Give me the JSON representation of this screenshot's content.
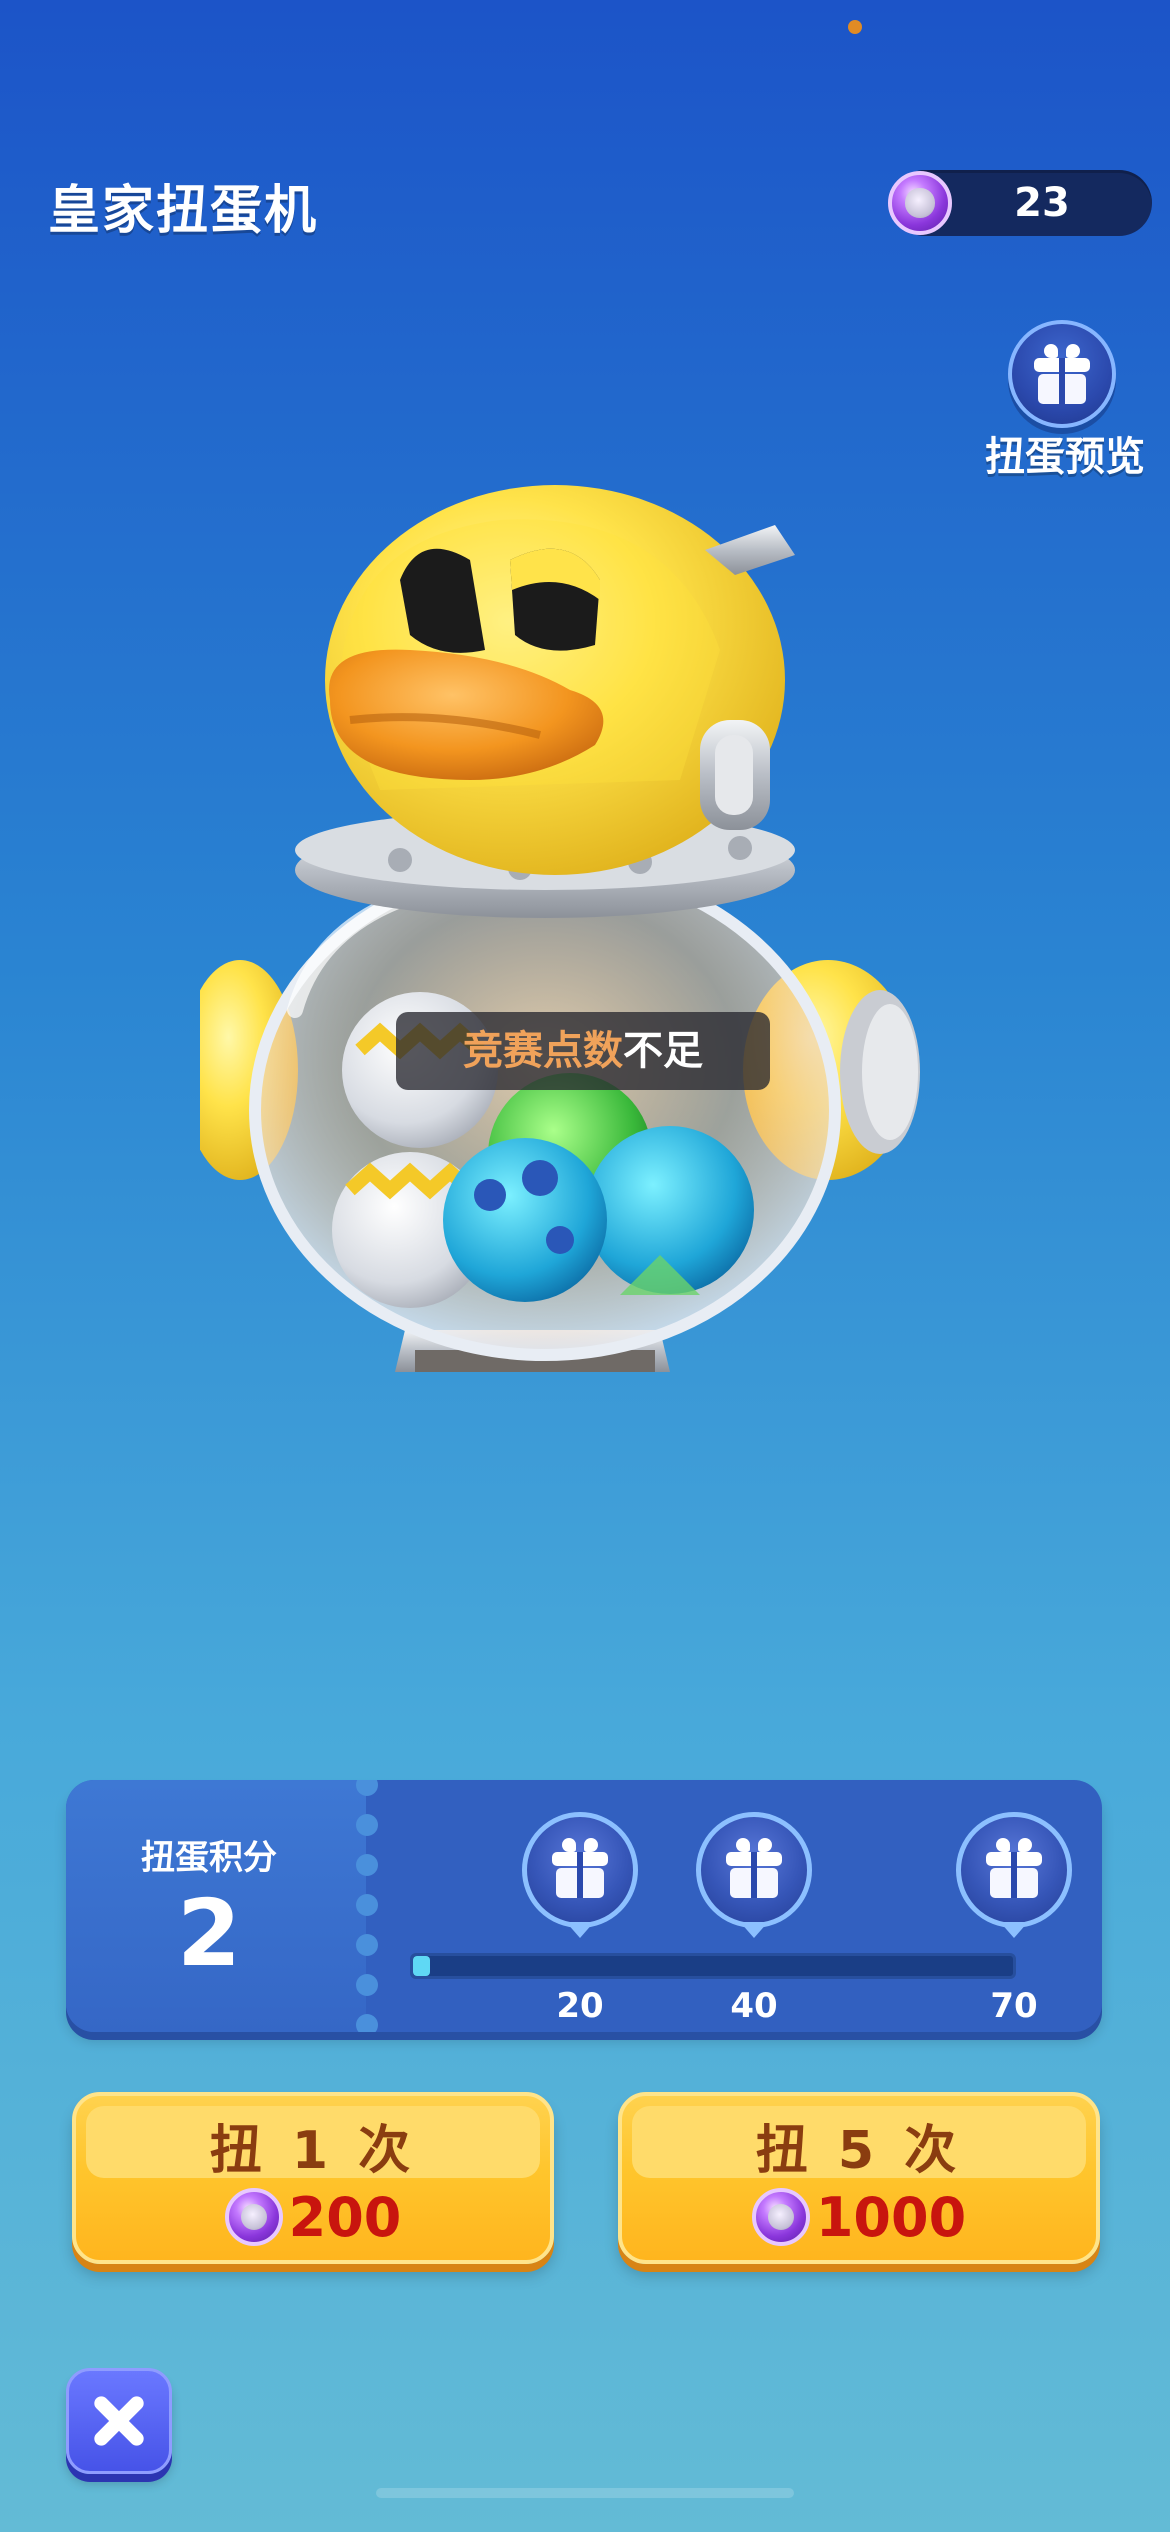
{
  "header": {
    "title": "皇家扭蛋机",
    "currency": {
      "icon": "ticket-coin-icon",
      "amount": "23"
    }
  },
  "preview": {
    "icon": "gift-icon",
    "label": "扭蛋预览"
  },
  "toast": {
    "highlight": "竞赛点数",
    "text": "不足"
  },
  "score_panel": {
    "label": "扭蛋积分",
    "value": "2",
    "progress": 2,
    "progress_max": 70,
    "milestones": [
      {
        "threshold": "20",
        "icon": "gift-icon"
      },
      {
        "threshold": "40",
        "icon": "gift-icon"
      },
      {
        "threshold": "70",
        "icon": "gift-icon"
      }
    ]
  },
  "actions": [
    {
      "label": "扭 1 次",
      "cost": "200",
      "icon": "ticket-coin-icon"
    },
    {
      "label": "扭 5 次",
      "cost": "1000",
      "icon": "ticket-coin-icon"
    }
  ],
  "close": {
    "icon": "close-icon"
  },
  "colors": {
    "accent_orange": "#f0a25a",
    "cost_red": "#c8150e",
    "button_yellow": "#ffc52c",
    "panel_blue": "#3260c0"
  }
}
